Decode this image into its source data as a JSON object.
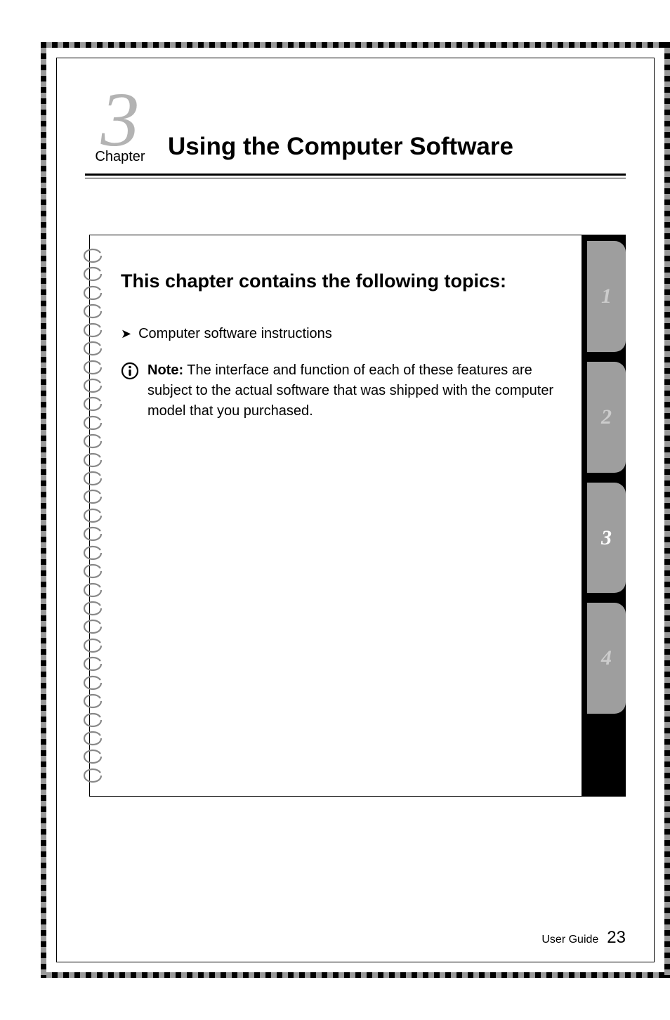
{
  "chapter": {
    "number": "3",
    "label": "Chapter",
    "title": "Using the Computer Software"
  },
  "card": {
    "heading": "This chapter contains the following topics:",
    "bullet_items": [
      "Computer software instructions"
    ],
    "note_label": "Note:",
    "note_text": " The interface and function of each of these features are subject to the actual software that was shipped with the computer model that you purchased."
  },
  "tabs": [
    {
      "label": "1",
      "active": false
    },
    {
      "label": "2",
      "active": false
    },
    {
      "label": "3",
      "active": true
    },
    {
      "label": "4",
      "active": false
    }
  ],
  "footer": {
    "guide_label": "User Guide",
    "page_number": "23"
  }
}
